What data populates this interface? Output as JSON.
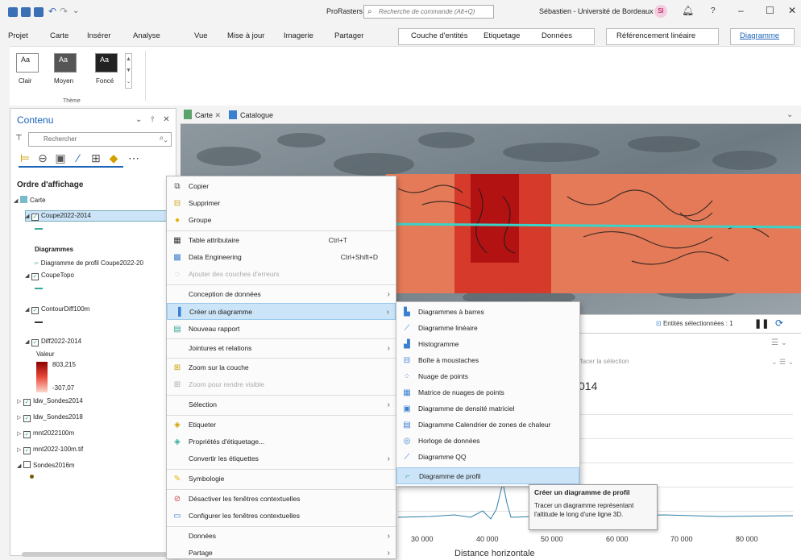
{
  "titlebar": {
    "project": "ProRasters",
    "search_placeholder": "Recherche de commande (Alt+Q)",
    "user": "Sébastien - Université de Bordeaux",
    "user_initials": "SI"
  },
  "ribbon": {
    "tabs": [
      "Projet",
      "Carte",
      "Insérer",
      "Analyse",
      "Vue",
      "Mise à jour",
      "Imagerie",
      "Partager"
    ],
    "context_tabs": [
      "Couche d'entités",
      "Etiquetage",
      "Données",
      "Référencement linéaire",
      "Diagramme"
    ],
    "active_tab": "Diagramme",
    "theme_options": [
      {
        "tile": "Aa",
        "label": "Clair"
      },
      {
        "tile": "Aa",
        "label": "Moyen"
      },
      {
        "tile": "Aa",
        "label": "Foncé"
      }
    ],
    "group_label": "Thème"
  },
  "contents": {
    "title": "Contenu",
    "search_placeholder": "Rechercher",
    "drawing_order": "Ordre d'affichage",
    "map_name": "Carte",
    "layers": {
      "coupe": "Coupe2022-2014",
      "diagrams_header": "Diagrammes",
      "profile_chart": "Diagramme de profil Coupe2022-20",
      "coupetopo": "CoupeTopo",
      "contour": "ContourDiff100m",
      "diff": "Diff2022-2014",
      "value_label": "Valeur",
      "value_max": "803,215",
      "value_min": "-307,07",
      "sondes2014": "Idw_Sondes2014",
      "sondes2018": "Idw_Sondes2018",
      "mnt2022": "mnt2022100m",
      "mnt2022tif": "mnt2022-100m.tif",
      "sondes2016": "Sondes2016m"
    }
  },
  "doc_tabs": [
    "Carte",
    "Catalogue"
  ],
  "map_status": "Entités sélectionnées : 1",
  "chart": {
    "clear_selection": "Effacer la sélection",
    "title_fragment": "014",
    "x_ticks": [
      "30 000",
      "40 000",
      "50 000",
      "60 000",
      "70 000",
      "80 000"
    ],
    "xlabel": "Distance horizontale"
  },
  "context_menu": {
    "items": [
      {
        "label": "Copier",
        "icon": "copy-icon"
      },
      {
        "label": "Supprimer",
        "icon": "remove-icon"
      },
      {
        "label": "Groupe",
        "icon": "group-icon"
      },
      {
        "label": "Table attributaire",
        "shortcut": "Ctrl+T",
        "icon": "table-icon"
      },
      {
        "label": "Data Engineering",
        "shortcut": "Ctrl+Shift+D",
        "icon": "data-engineering-icon"
      },
      {
        "label": "Ajouter des couches d'erreurs",
        "disabled": true,
        "icon": "error-layers-icon"
      },
      {
        "label": "Conception de données",
        "submenu": true
      },
      {
        "label": "Créer un diagramme",
        "submenu": true,
        "icon": "chart-icon"
      },
      {
        "label": "Nouveau rapport",
        "icon": "report-icon"
      },
      {
        "label": "Jointures et relations",
        "submenu": true
      },
      {
        "label": "Zoom sur la couche",
        "icon": "zoom-layer-icon"
      },
      {
        "label": "Zoom pour rendre visible",
        "disabled": true,
        "icon": "zoom-visible-icon"
      },
      {
        "label": "Sélection",
        "submenu": true
      },
      {
        "label": "Etiqueter",
        "icon": "label-icon"
      },
      {
        "label": "Propriétés d'étiquetage...",
        "icon": "label-props-icon"
      },
      {
        "label": "Convertir les étiquettes",
        "submenu": true
      },
      {
        "label": "Symbologie",
        "icon": "symbology-icon"
      },
      {
        "label": "Désactiver les fenêtres contextuelles",
        "icon": "popup-off-icon"
      },
      {
        "label": "Configurer les fenêtres contextuelles",
        "icon": "popup-config-icon"
      },
      {
        "label": "Données",
        "submenu": true
      },
      {
        "label": "Partage",
        "submenu": true
      }
    ]
  },
  "chart_submenu": {
    "items": [
      "Diagrammes à barres",
      "Diagramme linéaire",
      "Histogramme",
      "Boîte à moustaches",
      "Nuage de points",
      "Matrice de nuages de points",
      "Diagramme de densité matriciel",
      "Diagramme Calendrier de zones de chaleur",
      "Horloge de données",
      "Diagramme QQ",
      "Diagramme de profil"
    ]
  },
  "tooltip": {
    "title": "Créer un diagramme de profil",
    "description": "Tracer un diagramme représentant l'altitude le long d'une ligne 3D."
  }
}
